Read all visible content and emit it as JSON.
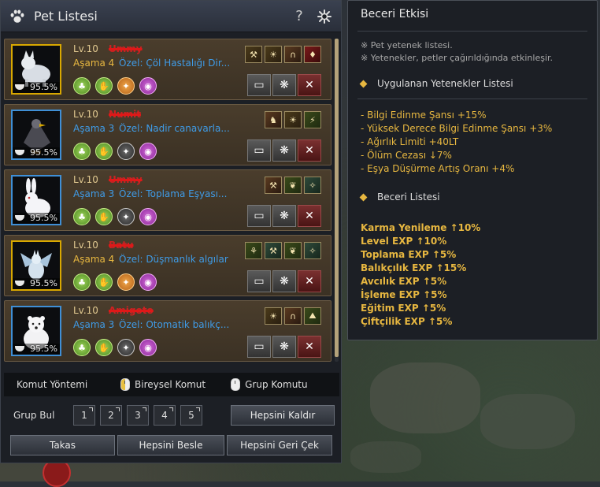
{
  "pet_panel": {
    "title": "Pet Listesi",
    "icons": {
      "title": "paw-icon",
      "help": "?",
      "settings": "gear-icon"
    },
    "pets": [
      {
        "level": "Lv.10",
        "name": "Ummy",
        "stage": "Aşama 4",
        "stage_color": "gold",
        "special": "Özel: Çöl Hastalığı Dir...",
        "hunger": "95.5%",
        "portrait": "gold",
        "animal": "wolf"
      },
      {
        "level": "Lv.10",
        "name": "Numit",
        "stage": "Aşama 3",
        "stage_color": "blue",
        "special": "Özel: Nadir canavarla...",
        "hunger": "95.5%",
        "portrait": "blue",
        "animal": "eagle"
      },
      {
        "level": "Lv.10",
        "name": "Ummy",
        "stage": "Aşama 3",
        "stage_color": "blue",
        "special": "Özel: Toplama Eşyası...",
        "hunger": "95.5%",
        "portrait": "blue",
        "animal": "rabbit"
      },
      {
        "level": "Lv.10",
        "name": "Batu",
        "stage": "Aşama 4",
        "stage_color": "gold",
        "special": "Özel: Düşmanlık algılar",
        "hunger": "95.5%",
        "portrait": "gold",
        "animal": "dragon"
      },
      {
        "level": "Lv.10",
        "name": "Amigoto",
        "stage": "Aşama 3",
        "stage_color": "blue",
        "special": "Özel: Otomatik balıkç...",
        "hunger": "95.5%",
        "portrait": "blue",
        "animal": "bear"
      }
    ],
    "command_row": {
      "label": "Komut Yöntemi",
      "individual": "Bireysel Komut",
      "group": "Grup Komutu"
    },
    "group_row": {
      "label": "Grup Bul",
      "slots": [
        "1",
        "2",
        "3",
        "4",
        "5"
      ],
      "release_all": "Hepsini Kaldır"
    },
    "bottom_buttons": {
      "trade": "Takas",
      "feed_all": "Hepsini Besle",
      "recall_all": "Hepsini Geri Çek"
    }
  },
  "skill_panel": {
    "title": "Beceri Etkisi",
    "notes": [
      "※ Pet yetenek listesi.",
      "※ Yetenekler, petler çağırıldığında etkinleşir."
    ],
    "applied_header": "Uygulanan Yetenekler Listesi",
    "applied": [
      "- Bilgi Edinme Şansı +15%",
      "- Yüksek Derece Bilgi Edinme Şansı +3%",
      "- Ağırlık Limiti +40LT",
      "- Ölüm Cezası ↓7%",
      "- Eşya Düşürme Artış Oranı +4%"
    ],
    "skills_header": "Beceri Listesi",
    "skills": [
      "Karma Yenileme ↑10%",
      "Level EXP ↑10%",
      "Toplama EXP ↑5%",
      "Balıkçılık EXP ↑15%",
      "Avcılık EXP ↑5%",
      "İşleme EXP ↑5%",
      "Eğitim EXP ↑5%",
      "Çiftçilik EXP ↑5%"
    ]
  },
  "colors": {
    "gold_text": "#e7b740",
    "blue_text": "#3f9be6",
    "panel_bg": "#1c1f25",
    "card_bg": "#4a3d2c"
  }
}
